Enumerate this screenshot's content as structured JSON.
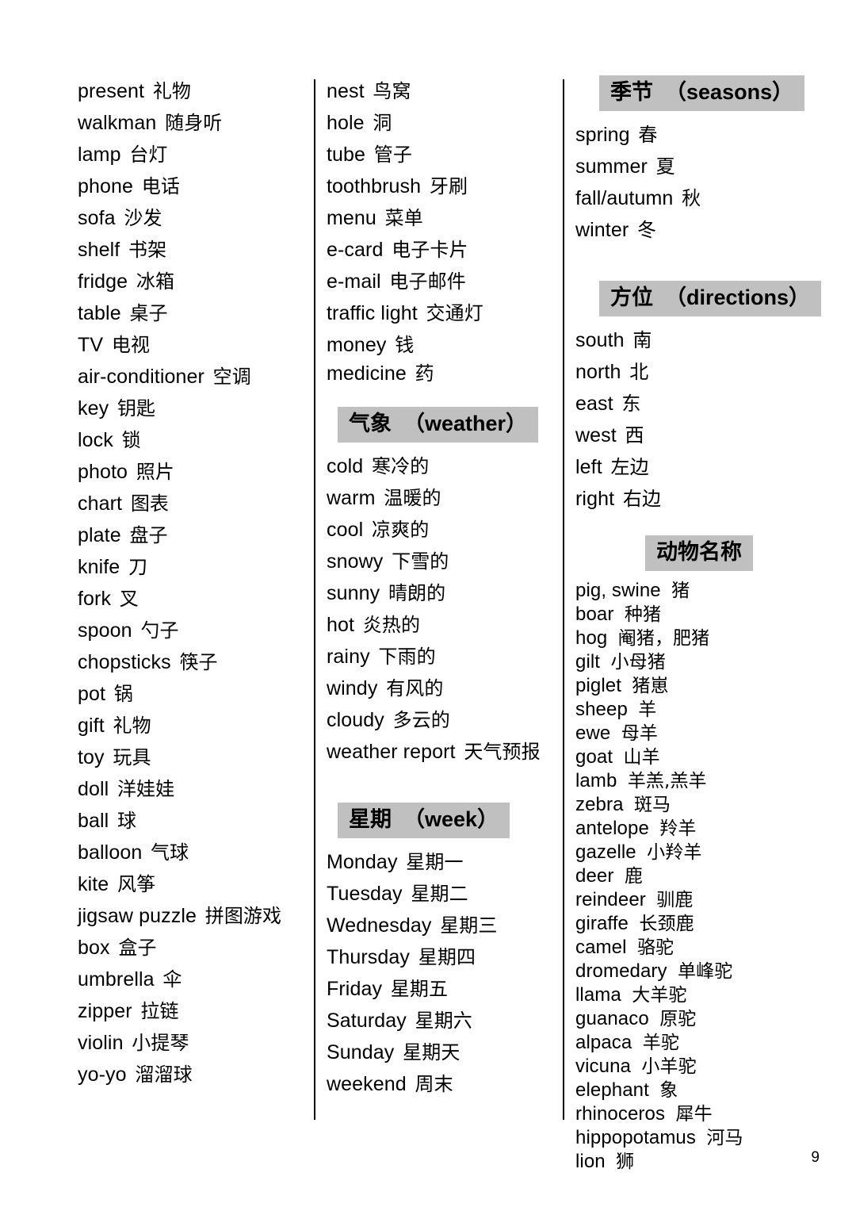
{
  "page": {
    "number": "9",
    "accent_gray": "#c0c0c0",
    "text_color": "#000000",
    "background": "#ffffff"
  },
  "columns": [
    {
      "id": "column-1",
      "sections": [
        {
          "id": "household-objects-continued",
          "header": null,
          "entries": [
            {
              "en": "present",
              "zh": "礼物"
            },
            {
              "en": "walkman",
              "zh": "随身听"
            },
            {
              "en": "lamp",
              "zh": "台灯"
            },
            {
              "en": "phone",
              "zh": "电话"
            },
            {
              "en": "sofa",
              "zh": "沙发"
            },
            {
              "en": "shelf",
              "zh": "书架"
            },
            {
              "en": "fridge",
              "zh": "冰箱"
            },
            {
              "en": "table",
              "zh": "桌子"
            },
            {
              "en": "TV",
              "zh": "电视"
            },
            {
              "en": "air-conditioner",
              "zh": "空调"
            },
            {
              "en": "key",
              "zh": "钥匙"
            },
            {
              "en": "lock",
              "zh": "锁"
            },
            {
              "en": "photo",
              "zh": "照片"
            },
            {
              "en": "chart",
              "zh": "图表"
            },
            {
              "en": "plate",
              "zh": "盘子"
            },
            {
              "en": "knife",
              "zh": "刀"
            },
            {
              "en": "fork",
              "zh": "叉"
            },
            {
              "en": "spoon",
              "zh": "勺子"
            },
            {
              "en": "chopsticks",
              "zh": "筷子"
            },
            {
              "en": "pot",
              "zh": "锅"
            },
            {
              "en": "gift",
              "zh": "礼物"
            },
            {
              "en": "toy",
              "zh": "玩具"
            },
            {
              "en": "doll",
              "zh": "洋娃娃"
            },
            {
              "en": "ball",
              "zh": "球"
            },
            {
              "en": "balloon",
              "zh": "气球"
            },
            {
              "en": "kite",
              "zh": "风筝"
            },
            {
              "en": "jigsaw puzzle",
              "zh": "拼图游戏"
            },
            {
              "en": "box",
              "zh": "盒子"
            },
            {
              "en": "umbrella",
              "zh": "伞"
            },
            {
              "en": "zipper",
              "zh": "拉链"
            },
            {
              "en": "violin",
              "zh": "小提琴"
            },
            {
              "en": "yo-yo",
              "zh": "溜溜球"
            }
          ]
        }
      ]
    },
    {
      "id": "column-2",
      "sections": [
        {
          "id": "objects-continued",
          "header": null,
          "entries": [
            {
              "en": "nest",
              "zh": "鸟窝"
            },
            {
              "en": "hole",
              "zh": "洞"
            },
            {
              "en": "tube",
              "zh": "管子"
            },
            {
              "en": "toothbrush",
              "zh": "牙刷"
            },
            {
              "en": "menu",
              "zh": "菜单"
            },
            {
              "en": "e-card",
              "zh": "电子卡片"
            },
            {
              "en": "e-mail",
              "zh": "电子邮件"
            },
            {
              "en": "traffic light",
              "zh": "交通灯"
            },
            {
              "en": "money",
              "zh": "钱"
            },
            {
              "en": "medicine",
              "zh": "药"
            }
          ]
        },
        {
          "id": "weather",
          "header": {
            "zh": "气象",
            "en": "（weather）"
          },
          "entries": [
            {
              "en": "cold",
              "zh": "寒冷的"
            },
            {
              "en": "warm",
              "zh": "温暖的"
            },
            {
              "en": "cool",
              "zh": "凉爽的"
            },
            {
              "en": "snowy",
              "zh": "下雪的"
            },
            {
              "en": "sunny",
              "zh": "晴朗的"
            },
            {
              "en": "hot",
              "zh": "炎热的"
            },
            {
              "en": "rainy",
              "zh": "下雨的"
            },
            {
              "en": "windy",
              "zh": "有风的"
            },
            {
              "en": "cloudy",
              "zh": "多云的"
            },
            {
              "en": "weather report",
              "zh": "天气预报"
            }
          ]
        },
        {
          "id": "week",
          "header": {
            "zh": "星期",
            "en": "（week）"
          },
          "entries": [
            {
              "en": "Monday",
              "zh": "星期一"
            },
            {
              "en": "Tuesday",
              "zh": "星期二"
            },
            {
              "en": "Wednesday",
              "zh": "星期三"
            },
            {
              "en": "Thursday",
              "zh": "星期四"
            },
            {
              "en": "Friday",
              "zh": "星期五"
            },
            {
              "en": "Saturday",
              "zh": "星期六"
            },
            {
              "en": "Sunday",
              "zh": "星期天"
            },
            {
              "en": "weekend",
              "zh": "周末"
            }
          ]
        }
      ]
    },
    {
      "id": "column-3",
      "sections": [
        {
          "id": "seasons",
          "header": {
            "zh": "季节",
            "en": "（seasons）"
          },
          "entries": [
            {
              "en": "spring",
              "zh": "春"
            },
            {
              "en": "summer",
              "zh": "夏"
            },
            {
              "en": "fall/autumn",
              "zh": "秋"
            },
            {
              "en": "winter",
              "zh": "冬"
            }
          ]
        },
        {
          "id": "directions",
          "header": {
            "zh": "方位",
            "en": "（directions）"
          },
          "entries": [
            {
              "en": "south",
              "zh": "南"
            },
            {
              "en": "north",
              "zh": "北"
            },
            {
              "en": "east",
              "zh": "东"
            },
            {
              "en": "west",
              "zh": "西"
            },
            {
              "en": "left",
              "zh": "左边"
            },
            {
              "en": "right",
              "zh": "右边"
            }
          ]
        },
        {
          "id": "animal-names",
          "header": {
            "zh": "动物名称",
            "en": ""
          },
          "entries": [
            {
              "en": "pig, swine",
              "zh": "猪"
            },
            {
              "en": "boar",
              "zh": "种猪"
            },
            {
              "en": "hog",
              "zh": "阉猪，肥猪"
            },
            {
              "en": "gilt",
              "zh": "小母猪"
            },
            {
              "en": "piglet",
              "zh": "猪崽"
            },
            {
              "en": "sheep",
              "zh": "羊"
            },
            {
              "en": "ewe",
              "zh": "母羊"
            },
            {
              "en": "goat",
              "zh": "山羊"
            },
            {
              "en": "lamb",
              "zh": "羊羔,羔羊"
            },
            {
              "en": "zebra",
              "zh": "斑马"
            },
            {
              "en": "antelope",
              "zh": "羚羊"
            },
            {
              "en": "gazelle",
              "zh": "小羚羊"
            },
            {
              "en": "deer",
              "zh": "鹿"
            },
            {
              "en": "reindeer",
              "zh": "驯鹿"
            },
            {
              "en": "giraffe",
              "zh": "长颈鹿"
            },
            {
              "en": "camel",
              "zh": "骆驼"
            },
            {
              "en": "dromedary",
              "zh": "单峰驼"
            },
            {
              "en": "llama",
              "zh": "大羊驼"
            },
            {
              "en": "guanaco",
              "zh": "原驼"
            },
            {
              "en": "alpaca",
              "zh": "羊驼"
            },
            {
              "en": "vicuna",
              "zh": "小羊驼"
            },
            {
              "en": "elephant",
              "zh": "象"
            },
            {
              "en": "rhinoceros",
              "zh": "犀牛"
            },
            {
              "en": "hippopotamus",
              "zh": "河马"
            },
            {
              "en": "lion",
              "zh": "狮"
            }
          ]
        }
      ]
    }
  ]
}
